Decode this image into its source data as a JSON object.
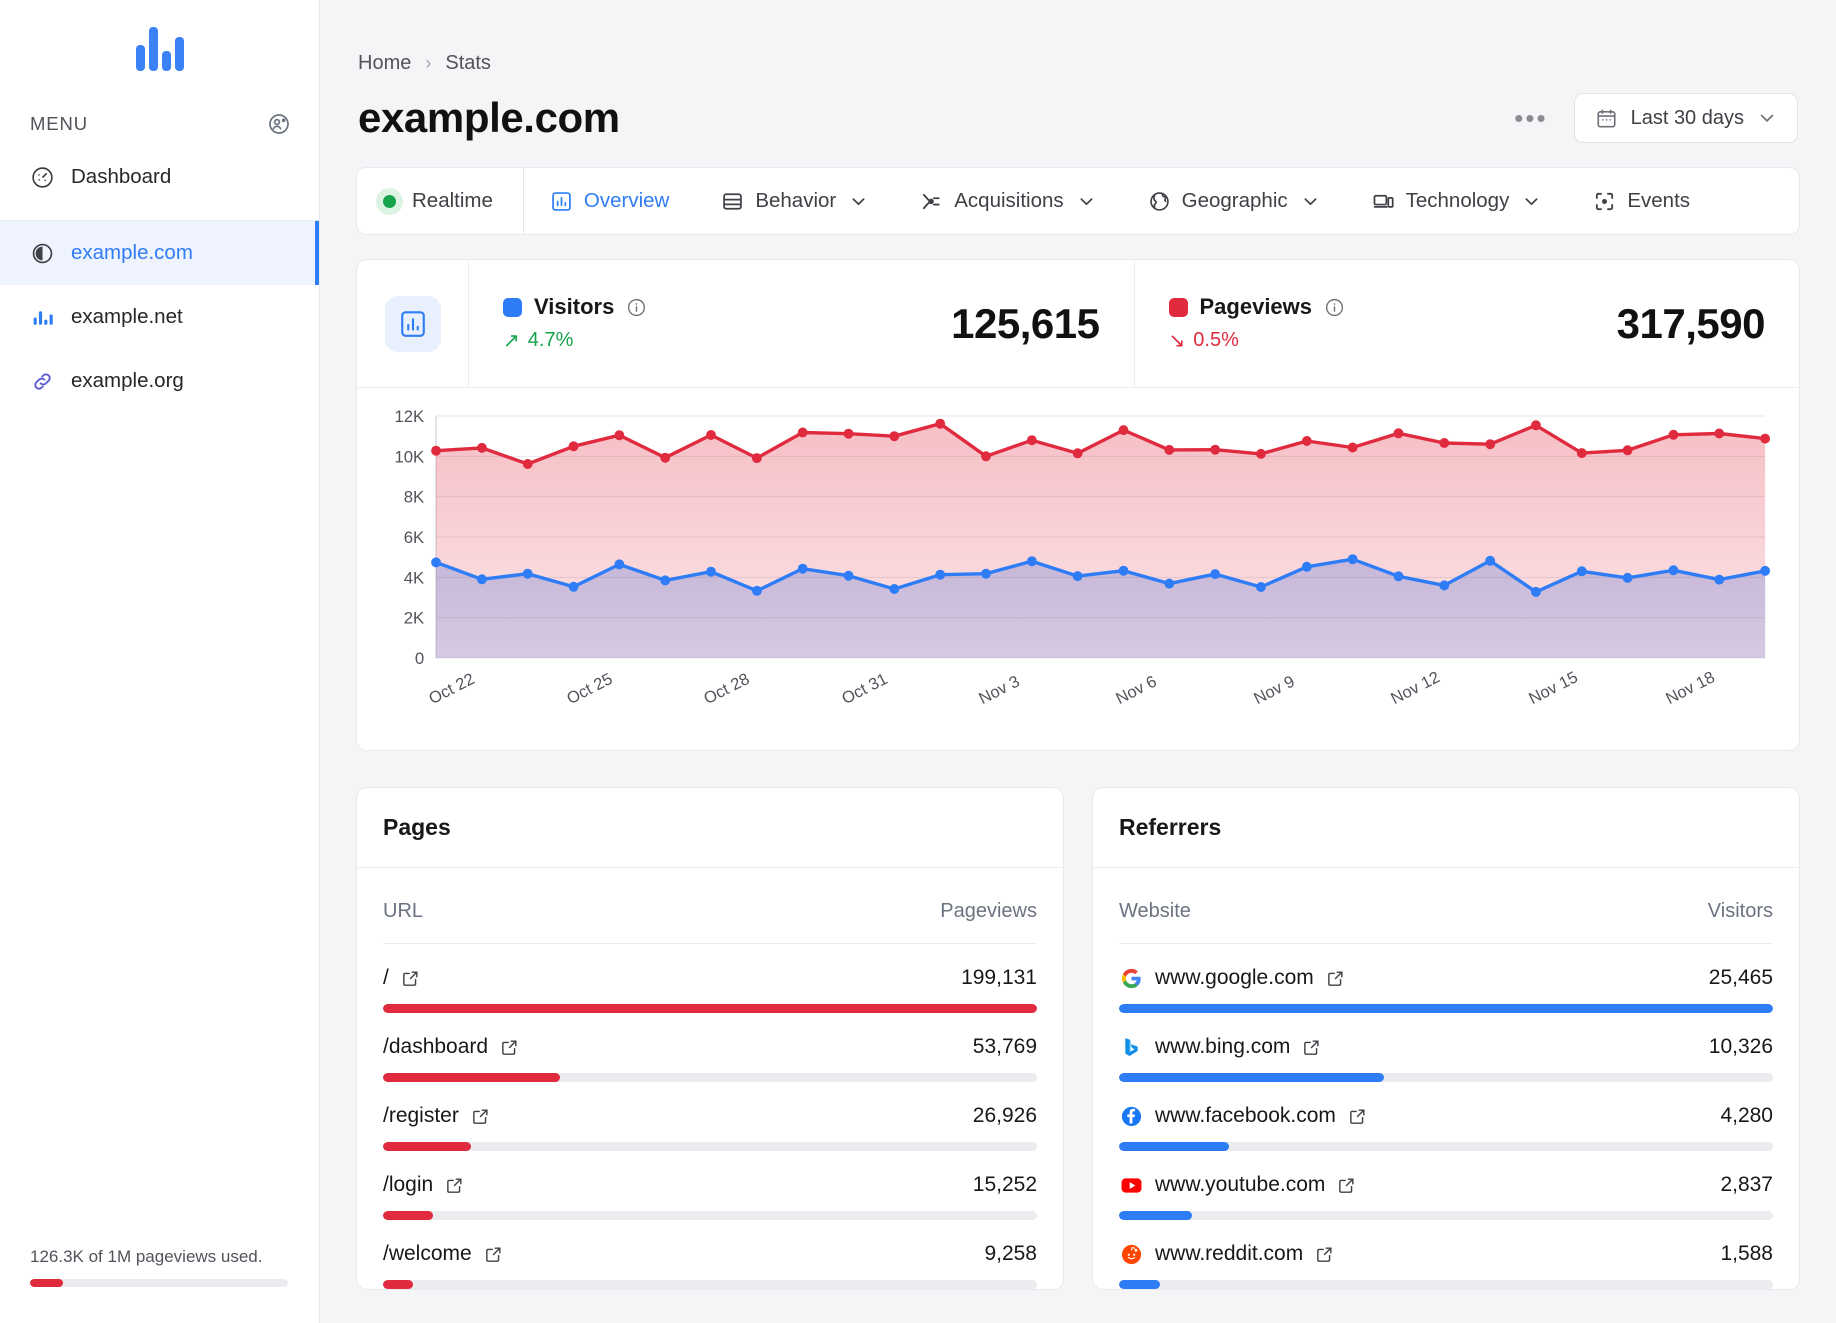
{
  "sidebar": {
    "logo": "bar-chart-logo",
    "menu_label": "MENU",
    "menu_action_icon": "contacts-icon",
    "nav": [
      {
        "label": "Dashboard",
        "icon": "gauge-icon",
        "active": false
      }
    ],
    "sites": [
      {
        "label": "example.com",
        "icon": "circle-half-icon",
        "active": true
      },
      {
        "label": "example.net",
        "icon": "bar-chart-icon",
        "active": false
      },
      {
        "label": "example.org",
        "icon": "link-icon",
        "active": false
      }
    ],
    "quota": {
      "text": "126.3K of 1M pageviews used.",
      "percent": 12.63,
      "color": "#e02b3f"
    }
  },
  "header": {
    "breadcrumb": [
      "Home",
      "Stats"
    ],
    "breadcrumb_separator": "›",
    "title": "example.com",
    "more_label": "•••",
    "date_range": "Last 30 days",
    "calendar_icon": "calendar-icon",
    "chevron_icon": "chevron-down-icon"
  },
  "tabs": [
    {
      "label": "Realtime",
      "icon": "green-dot-icon",
      "active": false,
      "dropdown": false
    },
    {
      "label": "Overview",
      "icon": "bar-chart-icon",
      "active": true,
      "dropdown": false
    },
    {
      "label": "Behavior",
      "icon": "layout-icon",
      "active": false,
      "dropdown": true
    },
    {
      "label": "Acquisitions",
      "icon": "branch-icon",
      "active": false,
      "dropdown": true
    },
    {
      "label": "Geographic",
      "icon": "globe-icon",
      "active": false,
      "dropdown": true
    },
    {
      "label": "Technology",
      "icon": "device-icon",
      "active": false,
      "dropdown": true
    },
    {
      "label": "Events",
      "icon": "target-icon",
      "active": false,
      "dropdown": false
    }
  ],
  "summary": {
    "icon": "chart-card-icon",
    "metrics": [
      {
        "name": "Visitors",
        "color": "#2f7df6",
        "value": "125,615",
        "delta": "4.7%",
        "direction": "up",
        "delta_arrow": "↗",
        "info_icon": "info-icon"
      },
      {
        "name": "Pageviews",
        "color": "#e02b3f",
        "value": "317,590",
        "delta": "0.5%",
        "direction": "down",
        "delta_arrow": "↘",
        "info_icon": "info-icon"
      }
    ]
  },
  "chart_data": {
    "type": "area",
    "title": "",
    "xlabel": "",
    "ylabel": "",
    "ylim": [
      0,
      12000
    ],
    "yticks": [
      0,
      2000,
      4000,
      6000,
      8000,
      10000,
      12000
    ],
    "ytick_labels": [
      "0",
      "2K",
      "4K",
      "6K",
      "8K",
      "10K",
      "12K"
    ],
    "grid": true,
    "legend_position": "top",
    "x": [
      "Oct 22",
      "Oct 23",
      "Oct 24",
      "Oct 25",
      "Oct 26",
      "Oct 27",
      "Oct 28",
      "Oct 29",
      "Oct 30",
      "Oct 31",
      "Nov 1",
      "Nov 2",
      "Nov 3",
      "Nov 4",
      "Nov 5",
      "Nov 6",
      "Nov 7",
      "Nov 8",
      "Nov 9",
      "Nov 10",
      "Nov 11",
      "Nov 12",
      "Nov 13",
      "Nov 14",
      "Nov 15",
      "Nov 16",
      "Nov 17",
      "Nov 18",
      "Nov 19",
      "Nov 20"
    ],
    "xtick_labels": [
      "Oct 22",
      "Oct 25",
      "Oct 28",
      "Oct 31",
      "Nov 3",
      "Nov 6",
      "Nov 9",
      "Nov 12",
      "Nov 15",
      "Nov 18"
    ],
    "xtick_indices": [
      0,
      3,
      6,
      9,
      12,
      15,
      18,
      21,
      24,
      27
    ],
    "series": [
      {
        "name": "Pageviews",
        "color": "#e02b3f",
        "values": [
          10280,
          10420,
          9620,
          10500,
          11050,
          9930,
          11060,
          9910,
          11180,
          11120,
          11000,
          11620,
          10000,
          10800,
          10150,
          11300,
          10320,
          10330,
          10120,
          10760,
          10440,
          11140,
          10660,
          10600,
          11540,
          10160,
          10300,
          11070,
          11130,
          10880
        ]
      },
      {
        "name": "Visitors",
        "color": "#2f7df6",
        "values": [
          4740,
          3900,
          4180,
          3530,
          4640,
          3850,
          4280,
          3330,
          4430,
          4080,
          3420,
          4130,
          4180,
          4800,
          4060,
          4330,
          3690,
          4160,
          3520,
          4520,
          4900,
          4050,
          3600,
          4820,
          3280,
          4300,
          3970,
          4350,
          3890,
          4320
        ]
      }
    ]
  },
  "pages_panel": {
    "title": "Pages",
    "columns": {
      "label": "URL",
      "value": "Pageviews"
    },
    "bar_color": "#e02b3f",
    "rows": [
      {
        "label": "/",
        "value": "199,131",
        "percent": 100,
        "icon": "external-link-icon"
      },
      {
        "label": "/dashboard",
        "value": "53,769",
        "percent": 27.0,
        "icon": "external-link-icon"
      },
      {
        "label": "/register",
        "value": "26,926",
        "percent": 13.5,
        "icon": "external-link-icon"
      },
      {
        "label": "/login",
        "value": "15,252",
        "percent": 7.7,
        "icon": "external-link-icon"
      },
      {
        "label": "/welcome",
        "value": "9,258",
        "percent": 4.6,
        "icon": "external-link-icon"
      }
    ]
  },
  "referrers_panel": {
    "title": "Referrers",
    "columns": {
      "label": "Website",
      "value": "Visitors"
    },
    "bar_color": "#2f7df6",
    "rows": [
      {
        "label": "www.google.com",
        "value": "25,465",
        "percent": 100,
        "favicon": "google-icon",
        "icon": "external-link-icon"
      },
      {
        "label": "www.bing.com",
        "value": "10,326",
        "percent": 40.5,
        "favicon": "bing-icon",
        "icon": "external-link-icon"
      },
      {
        "label": "www.facebook.com",
        "value": "4,280",
        "percent": 16.8,
        "favicon": "facebook-icon",
        "icon": "external-link-icon"
      },
      {
        "label": "www.youtube.com",
        "value": "2,837",
        "percent": 11.1,
        "favicon": "youtube-icon",
        "icon": "external-link-icon"
      },
      {
        "label": "www.reddit.com",
        "value": "1,588",
        "percent": 6.2,
        "favicon": "reddit-icon",
        "icon": "external-link-icon"
      }
    ]
  }
}
